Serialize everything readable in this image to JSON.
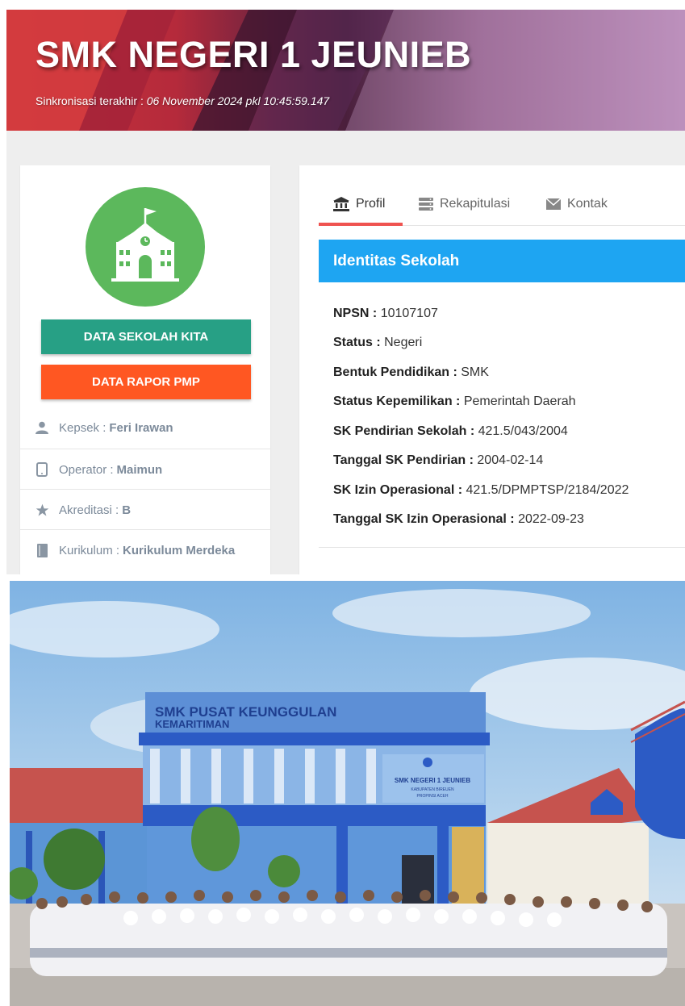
{
  "header": {
    "title": "SMK NEGERI 1 JEUNIEB",
    "sync_label": "Sinkronisasi terakhir :",
    "sync_date": "06 November 2024 pkl 10:45:59.147"
  },
  "sidebar": {
    "buttons": {
      "data_sekolah": "DATA SEKOLAH KITA",
      "data_rapor": "DATA RAPOR PMP"
    },
    "info": [
      {
        "label": "Kepsek :",
        "value": "Feri Irawan",
        "icon": "user-icon"
      },
      {
        "label": "Operator :",
        "value": "Maimun",
        "icon": "phone-icon"
      },
      {
        "label": "Akreditasi :",
        "value": "B",
        "icon": "star-icon"
      },
      {
        "label": "Kurikulum :",
        "value": "Kurikulum Merdeka",
        "icon": "book-icon"
      }
    ]
  },
  "tabs": [
    {
      "label": "Profil",
      "icon": "bank-icon",
      "active": true
    },
    {
      "label": "Rekapitulasi",
      "icon": "server-icon",
      "active": false
    },
    {
      "label": "Kontak",
      "icon": "envelope-icon",
      "active": false
    }
  ],
  "profile": {
    "heading": "Identitas Sekolah",
    "fields": [
      {
        "label": "NPSN :",
        "value": "10107107"
      },
      {
        "label": "Status :",
        "value": "Negeri"
      },
      {
        "label": "Bentuk Pendidikan :",
        "value": "SMK"
      },
      {
        "label": "Status Kepemilikan :",
        "value": "Pemerintah Daerah"
      },
      {
        "label": "SK Pendirian Sekolah :",
        "value": "421.5/043/2004"
      },
      {
        "label": "Tanggal SK Pendirian :",
        "value": "2004-02-14"
      },
      {
        "label": "SK Izin Operasional :",
        "value": "421.5/DPMPTSP/2184/2022"
      },
      {
        "label": "Tanggal SK Izin Operasional :",
        "value": "2022-09-23"
      }
    ]
  },
  "photo": {
    "sign_line1": "SMK PUSAT KEUNGGULAN",
    "sign_line2": "KEMARITIMAN",
    "plaque_line1": "SMK NEGERI 1 JEUNIEB",
    "plaque_line2": "KABUPATEN BIREUEN",
    "plaque_line3": "PROPINSI ACEH"
  },
  "colors": {
    "accent_blue": "#1ea5f2",
    "button_green": "#27a085",
    "button_orange": "#ff5722",
    "logo_green": "#5cb85c",
    "tab_active": "#ef5350"
  }
}
